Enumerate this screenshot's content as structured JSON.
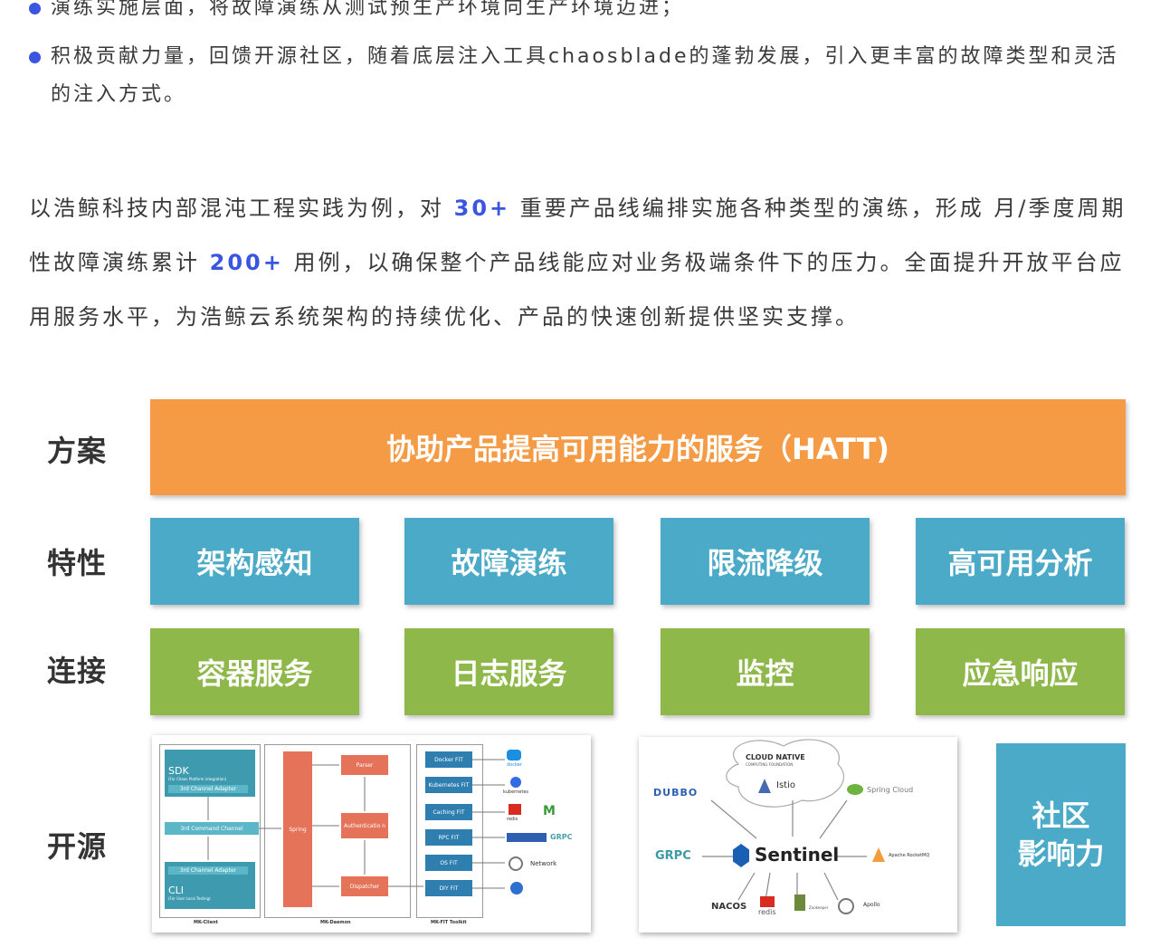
{
  "bullets": [
    "演练实施层面，将故障演练从测试预生产环境向生产环境迈进；",
    "积极贡献力量，回馈开源社区，随着底层注入工具chaosblade的蓬勃发展，引入更丰富的故障类型和灵活的注入方式。"
  ],
  "paragraph": {
    "part1": "以浩鲸科技内部混沌工程实践为例，对 ",
    "hl1": "30+",
    "part2": " 重要产品线编排实施各种类型的演练，形成 月/季度周期性故障演练累计 ",
    "hl2": "200+",
    "part3": " 用例，以确保整个产品线能应对业务极端条件下的压力。全面提升开放平台应用服务水平，为浩鲸云系统架构的持续优化、产品的快速创新提供坚实支撑。"
  },
  "diagram": {
    "rows": {
      "solution": "方案",
      "features": "特性",
      "connections": "连接",
      "opensource": "开源"
    },
    "solution_box": "协助产品提高可用能力的服务（HATT)",
    "features": [
      "架构感知",
      "故障演练",
      "限流降级",
      "高可用分析"
    ],
    "connections": [
      "容器服务",
      "日志服务",
      "监控",
      "应急响应"
    ],
    "community": [
      "社区",
      "影响力"
    ],
    "colors": {
      "orange": "#f59b46",
      "blue": "#4aaac7",
      "green": "#8eb84a",
      "accent": "#3a55e0"
    },
    "mk_panel": {
      "client_sdk": "SDK",
      "client_sdk_sub": "(For Chaos Platform integration)",
      "channel_adapter_top": "3rd Channel Adapter",
      "command_channel": "3rd Command Channel",
      "channel_adapter_bottom": "3rd Channel Adapter",
      "client_cli": "CLI",
      "client_cli_sub": "(For User Local Testing)",
      "spring": "Spring",
      "parser": "Parser",
      "auth": "Authenticatio n",
      "dispatch": "Dispatcher",
      "fits": [
        "Docker FIT",
        "Kubernetes FIT",
        "Caching FIT",
        "RPC FIT",
        "OS FIT",
        "DIY FIT"
      ],
      "targets": [
        "docker",
        "kubernetes",
        "redis",
        "GRPC",
        "Network"
      ],
      "footers": [
        "MK-Client",
        "MK-Daemon",
        "MK-FIT Toolkit"
      ]
    },
    "sentinel_panel": {
      "cncf": "CLOUD NATIVE",
      "cncf_sub": "COMPUTING FOUNDATION",
      "istio": "Istio",
      "spring_cloud": "Spring Cloud",
      "dubbo": "DUBBO",
      "grpc": "GRPC",
      "sentinel": "Sentinel",
      "rocketmq": "Apache RocketMQ",
      "nacos": "NACOS",
      "redis": "redis",
      "zookeeper": "Zookeeper",
      "apollo": "Apollo"
    }
  }
}
